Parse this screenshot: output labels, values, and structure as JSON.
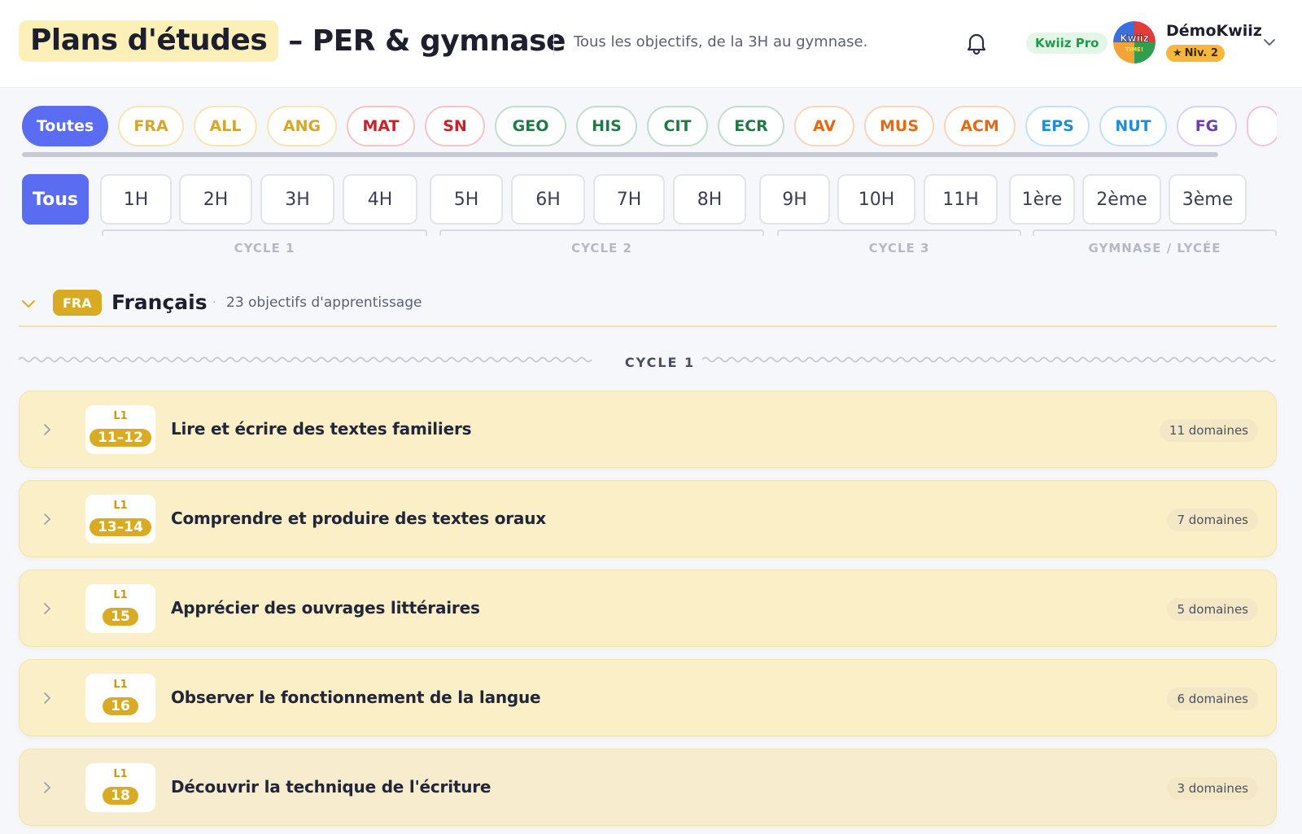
{
  "header": {
    "title_highlight": "Plans d'études",
    "title_rest": "– PER & gymnase",
    "subtitle": "Tous les objectifs, de la 3H au gymnase.",
    "pro_badge": "Kwiiz Pro",
    "avatar_text_top": "Kwiiz",
    "avatar_text_bottom": "TIME!",
    "user_name": "DémoKwiiz",
    "level_badge": "Niv. 2"
  },
  "subjects": [
    {
      "label": "Toutes",
      "color": "#5a6cf2",
      "border": "#5a6cf2",
      "active": true
    },
    {
      "label": "FRA",
      "color": "#d4a72c",
      "border": "#f4e6b5"
    },
    {
      "label": "ALL",
      "color": "#d4a72c",
      "border": "#f4e6b5"
    },
    {
      "label": "ANG",
      "color": "#d4a72c",
      "border": "#f4e6b5"
    },
    {
      "label": "MAT",
      "color": "#c8232c",
      "border": "#f3c6c6"
    },
    {
      "label": "SN",
      "color": "#c8232c",
      "border": "#f3c6c6"
    },
    {
      "label": "GEO",
      "color": "#1f7a47",
      "border": "#c3dccb"
    },
    {
      "label": "HIS",
      "color": "#1f7a47",
      "border": "#c3dccb"
    },
    {
      "label": "CIT",
      "color": "#1f7a47",
      "border": "#c3dccb"
    },
    {
      "label": "ECR",
      "color": "#1f7a47",
      "border": "#c3dccb"
    },
    {
      "label": "AV",
      "color": "#e36a12",
      "border": "#f6d6bd"
    },
    {
      "label": "MUS",
      "color": "#e36a12",
      "border": "#f6d6bd"
    },
    {
      "label": "ACM",
      "color": "#e36a12",
      "border": "#f6d6bd"
    },
    {
      "label": "EPS",
      "color": "#1c8fd6",
      "border": "#c5e2f4"
    },
    {
      "label": "NUT",
      "color": "#1c8fd6",
      "border": "#c5e2f4"
    },
    {
      "label": "FG",
      "color": "#6a3fb4",
      "border": "#dcd1ee"
    },
    {
      "label": "",
      "color": "#d9488a",
      "border": "#f2c4da"
    }
  ],
  "levels": [
    {
      "label": "Tous",
      "active": true
    },
    {
      "label": "1H"
    },
    {
      "label": "2H"
    },
    {
      "label": "3H"
    },
    {
      "label": "4H"
    },
    {
      "label": "5H"
    },
    {
      "label": "6H"
    },
    {
      "label": "7H"
    },
    {
      "label": "8H"
    },
    {
      "label": "9H"
    },
    {
      "label": "10H"
    },
    {
      "label": "11H"
    },
    {
      "label": "1ère"
    },
    {
      "label": "2ème"
    },
    {
      "label": "3ème"
    }
  ],
  "cycles": [
    "CYCLE 1",
    "CYCLE 2",
    "CYCLE 3",
    "GYMNASE / LYCÉE"
  ],
  "section": {
    "badge": "FRA",
    "title": "Français",
    "separator": "·",
    "count": "23 objectifs d'apprentissage",
    "cycle_divider": "CYCLE 1",
    "accent": "#d9ab24"
  },
  "objectives": [
    {
      "code_top": "L1",
      "code": "11–12",
      "title": "Lire et écrire des textes familiers",
      "domains": "11 domaines"
    },
    {
      "code_top": "L1",
      "code": "13–14",
      "title": "Comprendre et produire des textes oraux",
      "domains": "7 domaines"
    },
    {
      "code_top": "L1",
      "code": "15",
      "title": "Apprécier des ouvrages littéraires",
      "domains": "5 domaines"
    },
    {
      "code_top": "L1",
      "code": "16",
      "title": "Observer le fonctionnement de la langue",
      "domains": "6 domaines"
    },
    {
      "code_top": "L1",
      "code": "18",
      "title": "Découvrir la technique de l'écriture",
      "domains": "3 domaines"
    }
  ]
}
